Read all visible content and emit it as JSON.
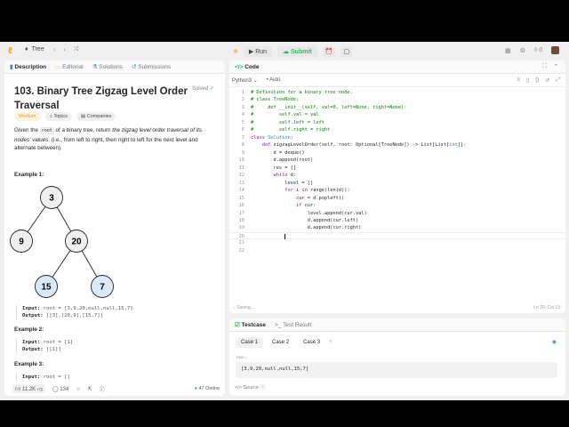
{
  "nav": {
    "problem_list": "Tree",
    "run": "Run",
    "submit": "Submit",
    "streak": "0"
  },
  "left": {
    "tabs": [
      "Description",
      "Editorial",
      "Solutions",
      "Submissions"
    ],
    "title": "103. Binary Tree Zigzag Level Order Traversal",
    "solved": "Solved",
    "difficulty": "Medium",
    "topics": "Topics",
    "companies": "Companies",
    "desc_pre": "Given the ",
    "desc_code": "root",
    "desc_mid": " of a binary tree, return ",
    "desc_em": "the zigzag level order traversal of its nodes' values",
    "desc_post": ". (i.e., from left to right, then right to left for the next level and alternate between).",
    "tree": {
      "nodes": [
        "3",
        "9",
        "20",
        "15",
        "7"
      ],
      "highlight_color": "#dbe8f8",
      "node_color": "#efefef"
    },
    "examples": [
      {
        "title": "Example 1:",
        "input": "root = [3,9,20,null,null,15,7]",
        "output": "[[3],[20,9],[15,7]]"
      },
      {
        "title": "Example 2:",
        "input": "root = [1]",
        "output": "[[1]]"
      },
      {
        "title": "Example 3:",
        "input": "root = []"
      }
    ],
    "input_label": "Input:",
    "output_label": "Output:",
    "likes": "11.2K",
    "comments": "134",
    "online": "47 Online"
  },
  "code": {
    "title": "Code",
    "language": "Python3",
    "auto": "Auto",
    "lines": [
      "# Definition for a binary tree node.",
      "# class TreeNode:",
      "#     def __init__(self, val=0, left=None, right=None):",
      "#         self.val = val",
      "#         self.left = left",
      "#         self.right = right",
      "class Solution:",
      "    def zigzagLevelOrder(self, root: Optional[TreeNode]) -> List[List[int]]:",
      "        d = deque()",
      "        d.append(root)",
      "        res = []",
      "        while d:",
      "            level = []",
      "            for i in range(len(d)):",
      "                cur = d.popleft()",
      "                if cur:",
      "                    level.append(cur.val)",
      "                    d.append(cur.left)",
      "                    d.append(cur.right)",
      "            ",
      "",
      ""
    ],
    "status": "Saving...",
    "cursor": "Ln 20, Col 13"
  },
  "testcase": {
    "tab1": "Testcase",
    "tab2": "Test Result",
    "cases": [
      "Case 1",
      "Case 2",
      "Case 3"
    ],
    "add": "+",
    "param": "root =",
    "value": "[3,9,20,null,null,15,7]",
    "source": "Source"
  }
}
